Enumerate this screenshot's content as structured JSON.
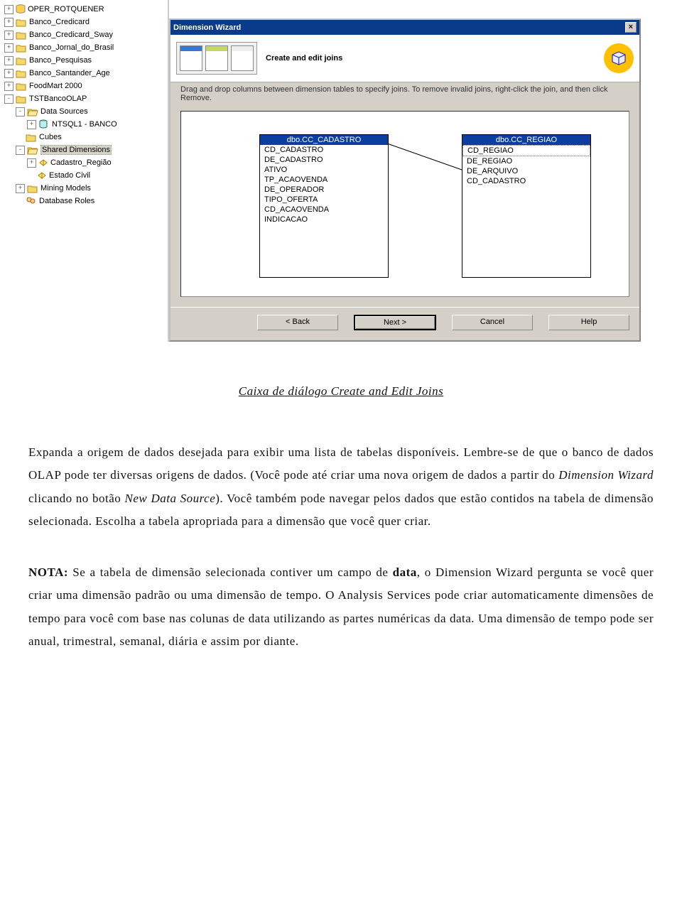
{
  "tree": {
    "items": [
      {
        "exp": "+",
        "icon": "cyl",
        "label": "OPER_ROTQUENER",
        "indent": 0
      },
      {
        "exp": "+",
        "icon": "folder",
        "label": "Banco_Credicard",
        "indent": 0
      },
      {
        "exp": "+",
        "icon": "folder",
        "label": "Banco_Credicard_Sway",
        "indent": 0
      },
      {
        "exp": "+",
        "icon": "folder",
        "label": "Banco_Jornal_do_Brasil",
        "indent": 0
      },
      {
        "exp": "+",
        "icon": "folder",
        "label": "Banco_Pesquisas",
        "indent": 0
      },
      {
        "exp": "+",
        "icon": "folder",
        "label": "Banco_Santander_Age",
        "indent": 0
      },
      {
        "exp": "+",
        "icon": "folder",
        "label": "FoodMart 2000",
        "indent": 0
      },
      {
        "exp": "-",
        "icon": "folder",
        "label": "TSTBancoOLAP",
        "indent": 0
      },
      {
        "exp": "-",
        "icon": "folder-open",
        "label": "Data Sources",
        "indent": 1
      },
      {
        "exp": "+",
        "icon": "db",
        "label": "NTSQL1 - BANCO",
        "indent": 2
      },
      {
        "exp": "",
        "icon": "folder",
        "label": "Cubes",
        "indent": 1
      },
      {
        "exp": "-",
        "icon": "folder-open",
        "label": "Shared Dimensions",
        "indent": 1,
        "selected": true
      },
      {
        "exp": "+",
        "icon": "dim",
        "label": "Cadastro_Região",
        "indent": 2
      },
      {
        "exp": "",
        "icon": "dim",
        "label": "Estado Civil",
        "indent": 2
      },
      {
        "exp": "+",
        "icon": "folder",
        "label": "Mining Models",
        "indent": 1
      },
      {
        "exp": "",
        "icon": "roles",
        "label": "Database Roles",
        "indent": 1
      }
    ]
  },
  "wizard": {
    "title": "Dimension Wizard",
    "heading": "Create and edit joins",
    "desc": "Drag and drop columns between dimension tables to specify joins. To remove invalid joins, right-click the join, and then click Remove.",
    "tables": [
      {
        "name": "dbo.CC_CADASTRO",
        "cols": [
          "CD_CADASTRO",
          "DE_CADASTRO",
          "ATIVO",
          "TP_ACAOVENDA",
          "DE_OPERADOR",
          "TIPO_OFERTA",
          "CD_ACAOVENDA",
          "INDICACAO"
        ]
      },
      {
        "name": "dbo.CC_REGIAO",
        "cols": [
          "CD_REGIAO",
          "DE_REGIAO",
          "DE_ARQUIVO",
          "CD_CADASTRO"
        ],
        "selected": 0
      }
    ],
    "buttons": {
      "back": "< Back",
      "next": "Next >",
      "cancel": "Cancel",
      "help": "Help"
    }
  },
  "doc": {
    "caption": " Caixa de diálogo Create and Edit Joins",
    "p1a": "Expanda a origem de dados desejada para exibir uma lista de tabelas disponíveis. Lembre-se de que o banco de dados OLAP pode ter diversas origens de dados. (Você pode até criar uma nova origem de dados a partir do ",
    "p1i": "Dimension Wizard",
    "p1b": " clicando no botão ",
    "p1i2": "New Data Source",
    "p1c": "). Você também pode navegar pelos dados que estão contidos na tabela de dimensão selecionada. Escolha a tabela apropriada para a dimensão que você quer criar.",
    "p2a": "NOTA:",
    "p2b": " Se a tabela de dimensão selecionada contiver um campo de ",
    "p2c": "data",
    "p2d": ", o Dimension Wizard pergunta se você quer criar uma dimensão padrão ou uma dimensão de tempo. O Analysis Services pode criar automaticamente dimensões de tempo para você com base nas colunas de data utilizando as partes numéricas da data. Uma dimensão de tempo pode ser anual, trimestral, semanal, diária e assim por diante."
  }
}
